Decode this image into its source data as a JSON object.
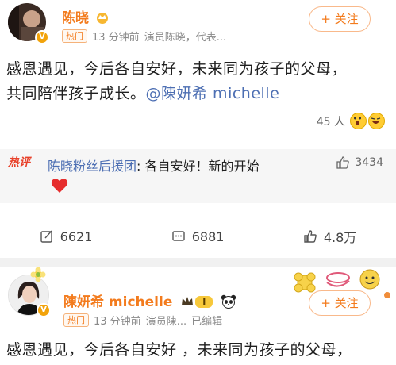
{
  "post1": {
    "author": "陈晓",
    "hot_tag": "热门",
    "time": "13 分钟前",
    "desc": "演员陈晓，代表...",
    "follow_label": "+ 关注",
    "text_line1": "感恩遇见，今后各自安好，未来同为孩子的父母，",
    "text_line2_prefix": "共同陪伴孩子成长。",
    "mention": "@陳妍希 michelle",
    "reactions_count": "45 人",
    "hot_comment_label": "热评",
    "comment_author": "陈晓粉丝后援团",
    "comment_text": ": 各自安好！新的开始",
    "comment_likes": "3434",
    "reposts": "6621",
    "comments": "6881",
    "likes": "4.8万"
  },
  "post2": {
    "author": "陳妍希 michelle",
    "vip_label": "I",
    "hot_tag": "热门",
    "time": "13 分钟前",
    "desc": "演员陳...",
    "edited": "已编辑",
    "follow_label": "+ 关注",
    "text_line1": "感恩遇见，今后各自安好 ，未来同为孩子的父母，"
  },
  "colors": {
    "accent": "#f37b1d",
    "link": "#4d6fb3",
    "hot_red": "#e8412a"
  }
}
